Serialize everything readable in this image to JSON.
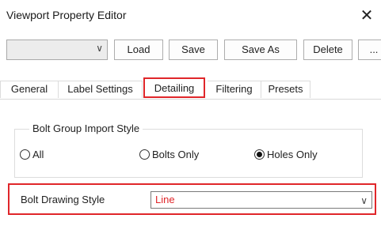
{
  "window": {
    "title": "Viewport Property Editor",
    "close_glyph": "✕"
  },
  "toolbar": {
    "preset_combo_value": "",
    "combo_arrow": "∨",
    "load_label": "Load",
    "save_label": "Save",
    "save_as_label": "Save As",
    "delete_label": "Delete",
    "more_label": "..."
  },
  "tabs": [
    {
      "label": "General"
    },
    {
      "label": "Label Settings"
    },
    {
      "label": "Detailing",
      "active": true
    },
    {
      "label": "Filtering"
    },
    {
      "label": "Presets"
    }
  ],
  "bolt_group_import": {
    "legend": "Bolt Group Import Style",
    "options": [
      {
        "label": "All",
        "selected": false
      },
      {
        "label": "Bolts Only",
        "selected": false
      },
      {
        "label": "Holes Only",
        "selected": true
      }
    ]
  },
  "bolt_drawing_style": {
    "label": "Bolt Drawing Style",
    "value": "Line",
    "value_color": "#e0262a",
    "arrow": "∨"
  },
  "colors": {
    "highlight": "#e0262a"
  }
}
